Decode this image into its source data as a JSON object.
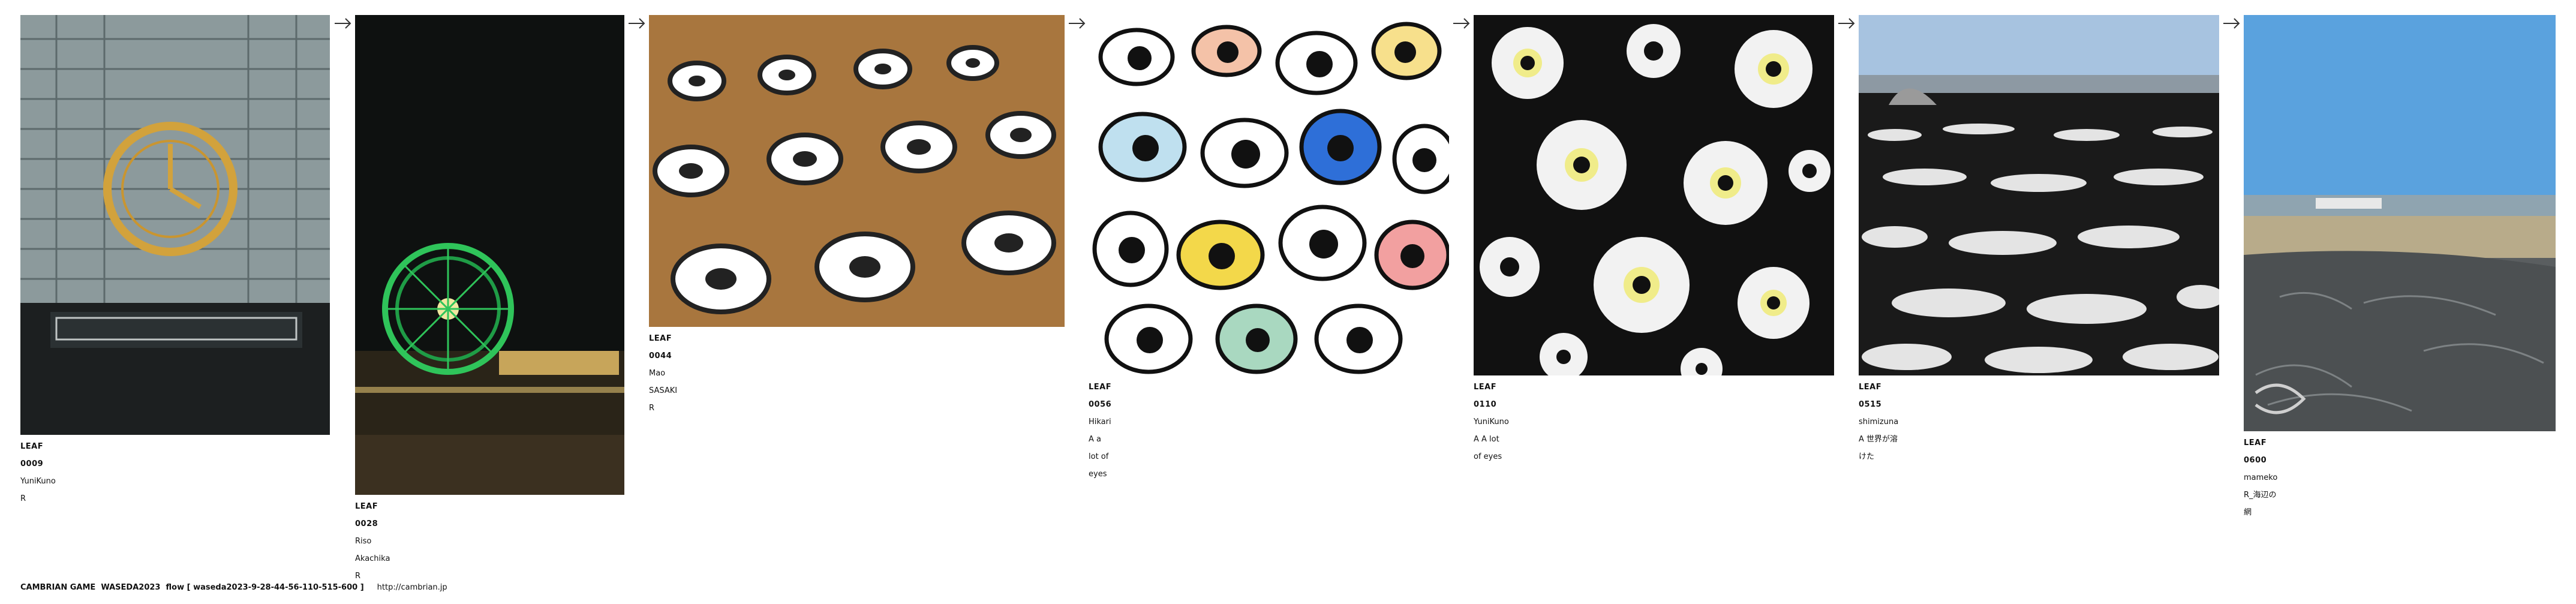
{
  "leaves": [
    {
      "id": "LEAF 0009",
      "author": "YuniKuno",
      "note": "R",
      "image_name": "hakata-station-clock-photo"
    },
    {
      "id": "LEAF 0028",
      "author": "Riso Akachika",
      "note": "R",
      "image_name": "ferris-wheel-night-photo"
    },
    {
      "id": "LEAF 0044",
      "author": "Mao SASAKI",
      "note": "R",
      "image_name": "target-discs-on-floor-photo"
    },
    {
      "id": "LEAF 0056",
      "author": "Hikari",
      "note": "A a lot of eyes",
      "image_name": "eyes-pattern-image"
    },
    {
      "id": "LEAF 0110",
      "author": "YuniKuno",
      "note": "A  A lot of eyes",
      "image_name": "black-white-eyes-image"
    },
    {
      "id": "LEAF 0515",
      "author": "shimizuna",
      "note": "A 世界が溶けた",
      "image_name": "melted-world-image"
    },
    {
      "id": "LEAF 0600",
      "author": "mameko",
      "note": "R_海辺の網",
      "image_name": "seaside-net-photo"
    }
  ],
  "footer": {
    "text": "CAMBRIAN GAME  WASEDA2023  flow [ waseda2023-9-28-44-56-110-515-600 ]",
    "url": "http://cambrian.jp"
  },
  "colors": {
    "text": "#111111",
    "background": "#ffffff",
    "arrow": "#333333"
  }
}
